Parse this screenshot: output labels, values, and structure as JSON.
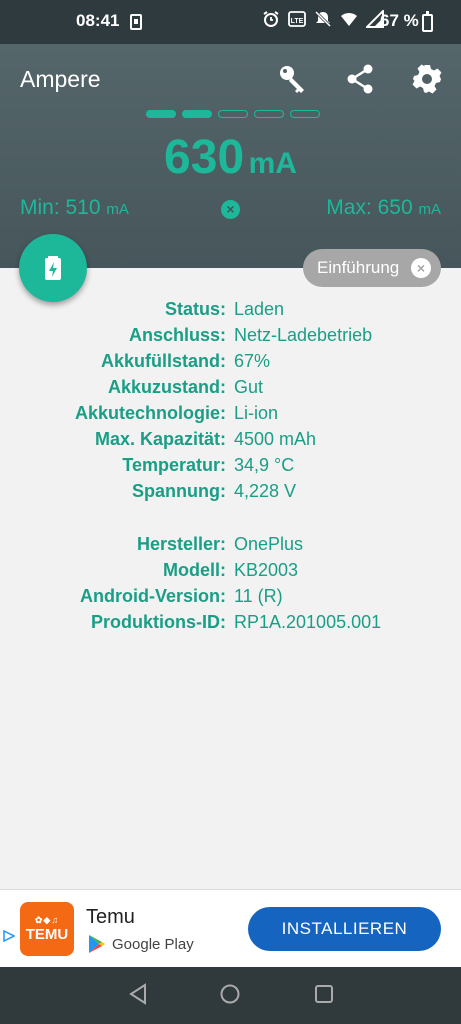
{
  "status": {
    "time": "08:41",
    "battery": "67 %"
  },
  "header": {
    "title": "Ampere"
  },
  "meter": {
    "current_value": "630",
    "current_unit": "mA",
    "segments_filled": 2,
    "segments_total": 5,
    "min_label": "Min: 510",
    "min_unit": "mA",
    "max_label": "Max: 650",
    "max_unit": "mA"
  },
  "intro_chip": {
    "label": "Einführung"
  },
  "info_rows": [
    {
      "label": "Status:",
      "value": "Laden"
    },
    {
      "label": "Anschluss:",
      "value": "Netz-Ladebetrieb"
    },
    {
      "label": "Akkufüllstand:",
      "value": "67%"
    },
    {
      "label": "Akkuzustand:",
      "value": "Gut"
    },
    {
      "label": "Akkutechnologie:",
      "value": "Li-ion"
    },
    {
      "label": "Max. Kapazität:",
      "value": "4500 mAh"
    },
    {
      "label": "Temperatur:",
      "value": "34,9 °C"
    },
    {
      "label": "Spannung:",
      "value": "4,228 V"
    }
  ],
  "device_rows": [
    {
      "label": "Hersteller:",
      "value": "OnePlus"
    },
    {
      "label": "Modell:",
      "value": "KB2003"
    },
    {
      "label": "Android-Version:",
      "value": "11 (R)"
    },
    {
      "label": "Produktions-ID:",
      "value": "RP1A.201005.001"
    }
  ],
  "ad": {
    "logo_text": "TEMU",
    "app_name": "Temu",
    "store_name": "Google Play",
    "install_label": "INSTALLIEREN"
  },
  "colors": {
    "accent": "#1db89a",
    "header": "#4f5f64",
    "install": "#1565c0"
  }
}
